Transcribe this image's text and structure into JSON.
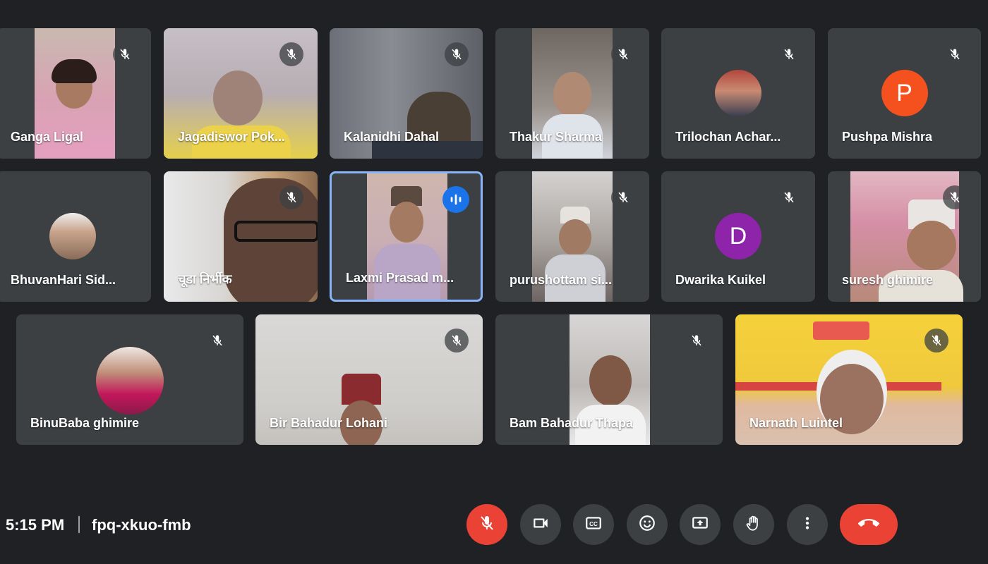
{
  "meeting": {
    "time": "5:15 PM",
    "code": "fpq-xkuo-fmb"
  },
  "participants": [
    {
      "name": "Ganga Ligal",
      "muted": true
    },
    {
      "name": "Jagadiswor Pok...",
      "muted": true
    },
    {
      "name": "Kalanidhi Dahal",
      "muted": true
    },
    {
      "name": "Thakur Sharma",
      "muted": true
    },
    {
      "name": "Trilochan Achar...",
      "muted": true
    },
    {
      "name": "Pushpa Mishra",
      "muted": true,
      "avatar_letter": "P",
      "avatar_color": "#f4511e"
    },
    {
      "name": "BhuvanHari Sid...",
      "muted": false
    },
    {
      "name": "चूडा निर्भीक",
      "muted": true
    },
    {
      "name": "Laxmi Prasad m...",
      "muted": false,
      "speaking": true
    },
    {
      "name": "purushottam si...",
      "muted": true
    },
    {
      "name": "Dwarika Kuikel",
      "muted": true,
      "avatar_letter": "D",
      "avatar_color": "#8e24aa"
    },
    {
      "name": "suresh ghimire",
      "muted": true
    },
    {
      "name": "BinuBaba ghimire",
      "muted": true
    },
    {
      "name": "Bir Bahadur Lohani",
      "muted": true
    },
    {
      "name": "Bam Bahadur Thapa",
      "muted": true
    },
    {
      "name": "Narnath Luintel",
      "muted": true
    }
  ],
  "controls": {
    "items": [
      {
        "icon": "mic-off-icon",
        "active": "muted"
      },
      {
        "icon": "camera-icon"
      },
      {
        "icon": "captions-icon"
      },
      {
        "icon": "emoji-icon"
      },
      {
        "icon": "present-screen-icon"
      },
      {
        "icon": "raise-hand-icon"
      },
      {
        "icon": "more-options-icon"
      },
      {
        "icon": "hang-up-icon"
      }
    ]
  },
  "colors": {
    "background": "#202124",
    "tile": "#3c4043",
    "accent": "#8ab4f8",
    "danger": "#ea4335",
    "speaking_badge": "#1a73e8"
  }
}
